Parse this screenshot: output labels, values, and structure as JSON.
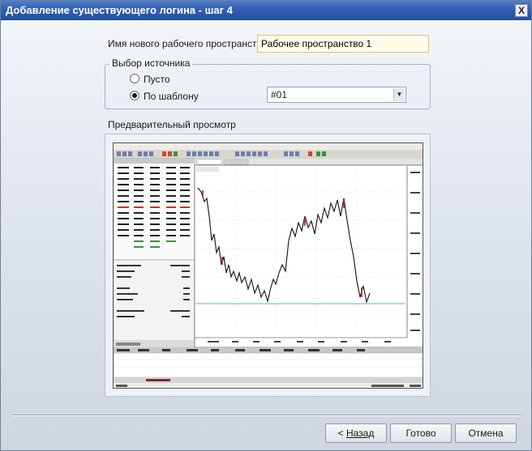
{
  "window": {
    "title": "Добавление существующего логина - шаг 4",
    "close_label": "X"
  },
  "workspace": {
    "label": "Имя нового рабочего пространства",
    "value": "Рабочее пространство 1"
  },
  "source": {
    "group_label": "Выбор источника",
    "options": [
      {
        "label": "Пусто",
        "checked": false
      },
      {
        "label": "По шаблону",
        "checked": true
      }
    ],
    "template_value": "#01"
  },
  "preview": {
    "label": "Предварительный просмотр",
    "colors": {
      "toolbar": "#d8d6cf",
      "chart_line": "#111111",
      "chart_red": "#b32222",
      "guide_line": "#2a9d9a",
      "grid": "#d9d9d9"
    }
  },
  "buttons": {
    "back_prefix": "< ",
    "back_label": "Назад",
    "finish_label": "Готово",
    "cancel_label": "Отмена"
  }
}
